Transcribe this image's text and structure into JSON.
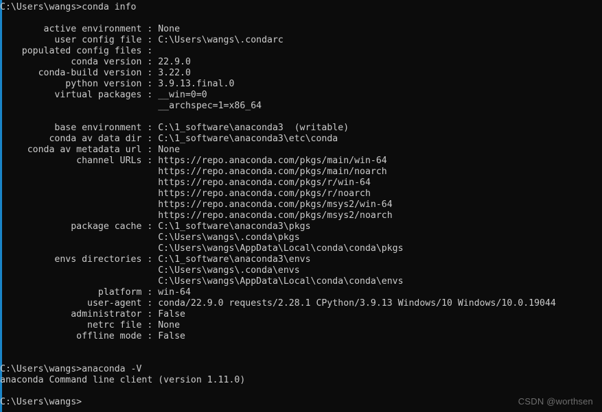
{
  "window": {
    "kind": "windows-command-prompt",
    "background_color": "#0c0c0c",
    "text_color": "#cccccc",
    "accent_bar_color": "#1a85c8"
  },
  "prompt": {
    "path": "C:\\Users\\wangs",
    "symbol": ">"
  },
  "commands": [
    {
      "prompt": "C:\\Users\\wangs>",
      "input": "conda info"
    },
    {
      "prompt": "C:\\Users\\wangs>",
      "input": "anaconda -V"
    }
  ],
  "conda_info": {
    "label_column_width": 26,
    "entries": [
      {
        "label": "active environment",
        "values": [
          "None"
        ]
      },
      {
        "label": "user config file",
        "values": [
          "C:\\Users\\wangs\\.condarc"
        ]
      },
      {
        "label": "populated config files",
        "values": [
          ""
        ]
      },
      {
        "label": "conda version",
        "values": [
          "22.9.0"
        ]
      },
      {
        "label": "conda-build version",
        "values": [
          "3.22.0"
        ]
      },
      {
        "label": "python version",
        "values": [
          "3.9.13.final.0"
        ]
      },
      {
        "label": "virtual packages",
        "values": [
          "__win=0=0",
          "__archspec=1=x86_64"
        ]
      },
      {
        "label": "",
        "values": []
      },
      {
        "label": "base environment",
        "values": [
          "C:\\1_software\\anaconda3  (writable)"
        ]
      },
      {
        "label": "conda av data dir",
        "values": [
          "C:\\1_software\\anaconda3\\etc\\conda"
        ]
      },
      {
        "label": "conda av metadata url",
        "values": [
          "None"
        ]
      },
      {
        "label": "channel URLs",
        "values": [
          "https://repo.anaconda.com/pkgs/main/win-64",
          "https://repo.anaconda.com/pkgs/main/noarch",
          "https://repo.anaconda.com/pkgs/r/win-64",
          "https://repo.anaconda.com/pkgs/r/noarch",
          "https://repo.anaconda.com/pkgs/msys2/win-64",
          "https://repo.anaconda.com/pkgs/msys2/noarch"
        ]
      },
      {
        "label": "package cache",
        "values": [
          "C:\\1_software\\anaconda3\\pkgs",
          "C:\\Users\\wangs\\.conda\\pkgs",
          "C:\\Users\\wangs\\AppData\\Local\\conda\\conda\\pkgs"
        ]
      },
      {
        "label": "envs directories",
        "values": [
          "C:\\1_software\\anaconda3\\envs",
          "C:\\Users\\wangs\\.conda\\envs",
          "C:\\Users\\wangs\\AppData\\Local\\conda\\conda\\envs"
        ]
      },
      {
        "label": "platform",
        "values": [
          "win-64"
        ]
      },
      {
        "label": "user-agent",
        "values": [
          "conda/22.9.0 requests/2.28.1 CPython/3.9.13 Windows/10 Windows/10.0.19044"
        ]
      },
      {
        "label": "administrator",
        "values": [
          "False"
        ]
      },
      {
        "label": "netrc file",
        "values": [
          "None"
        ]
      },
      {
        "label": "offline mode",
        "values": [
          "False"
        ]
      }
    ]
  },
  "anaconda_version_output": "anaconda Command line client (version 1.11.0)",
  "watermark": "CSDN @worthsen"
}
